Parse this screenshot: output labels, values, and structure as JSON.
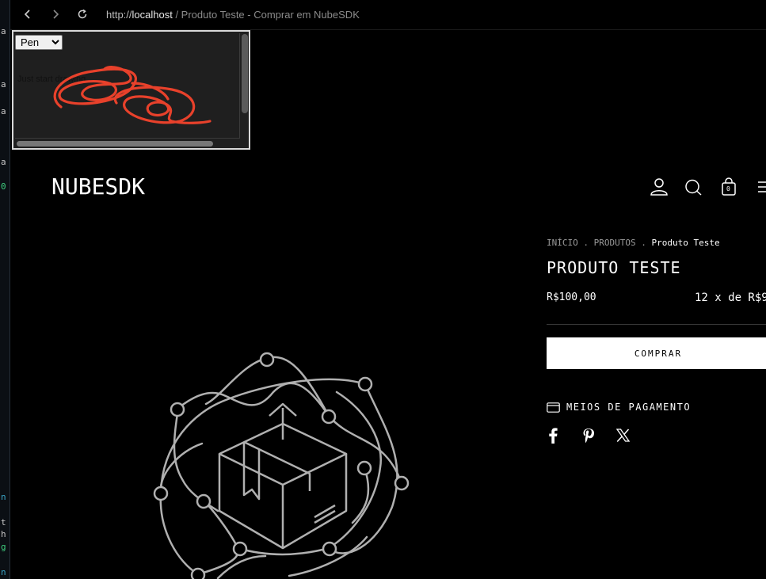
{
  "left_strip": {
    "chars": [
      "a",
      "a",
      "a",
      "a",
      "0",
      "n",
      "t",
      "h",
      "g",
      "n"
    ]
  },
  "browser": {
    "url_proto": "http://",
    "url_host": "localhost",
    "url_rest": " / Produto Teste - Comprar em NubeSDK"
  },
  "drawing_panel": {
    "tool_selected": "Pen",
    "tool_options": [
      "Pen"
    ],
    "hint": "Just start drawing",
    "stroke_color": "#e8412b"
  },
  "store": {
    "logo": "NUBESDK",
    "cart_count": "0"
  },
  "product": {
    "breadcrumb": {
      "home": "INÍCIO",
      "sep": ".",
      "products": "PRODUTOS",
      "current": "Produto Teste"
    },
    "title": "PRODUTO TESTE",
    "price": "R$100,00",
    "installments": "12 x de R$9",
    "buy_label": "COMPRAR",
    "payment_label": "MEIOS DE PAGAMENTO"
  },
  "colors": {
    "background": "#000000",
    "illustration": "#b0b0b0"
  }
}
